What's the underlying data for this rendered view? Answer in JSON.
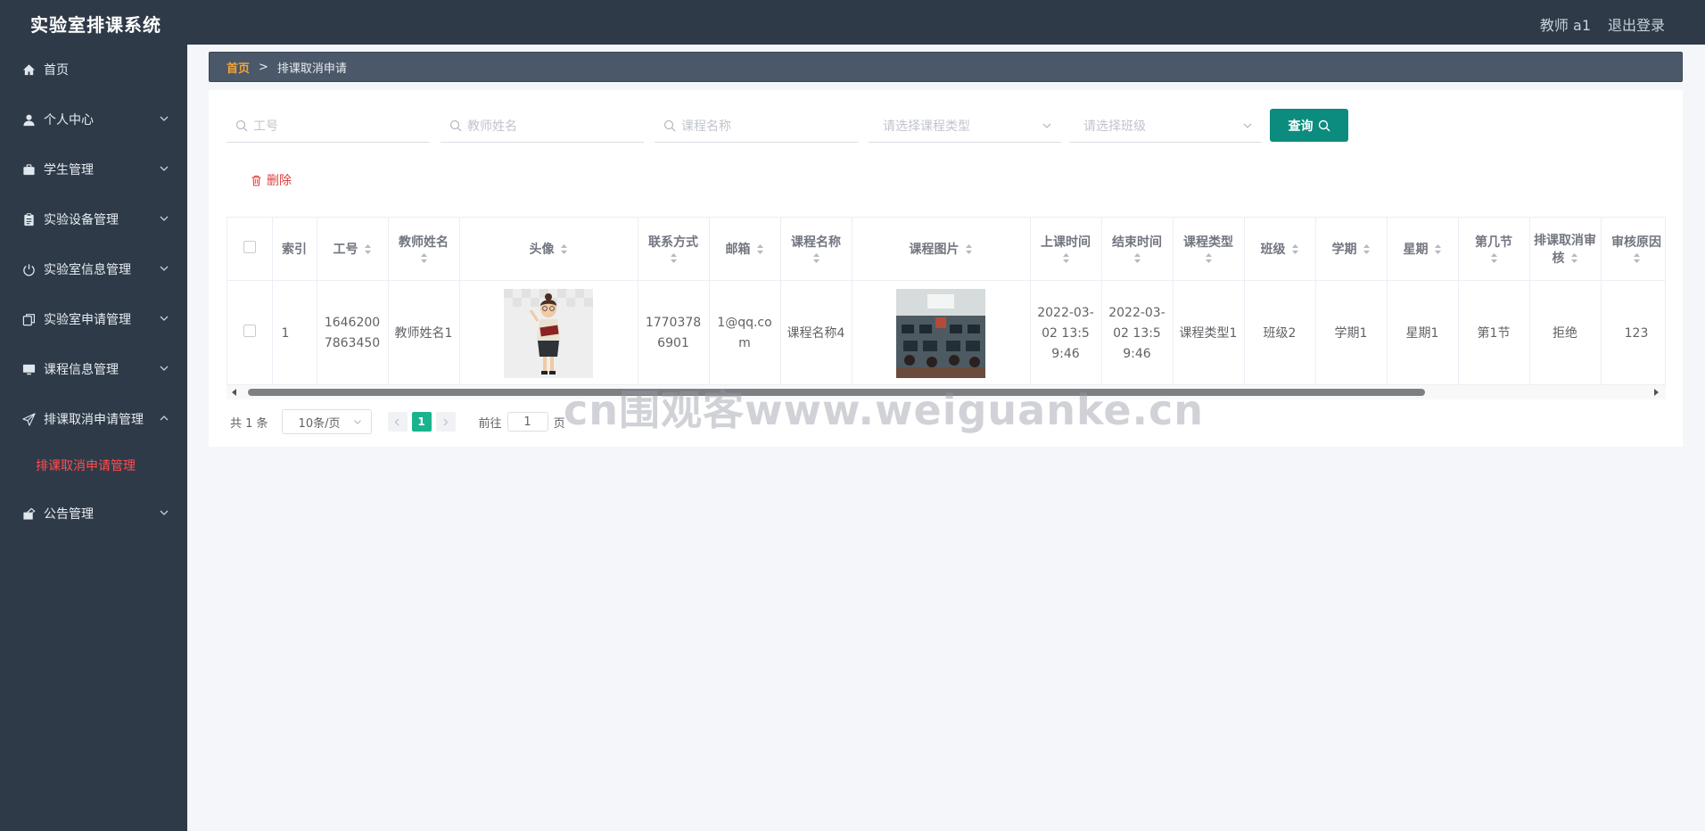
{
  "app": {
    "title": "实验室排课系统"
  },
  "topbar": {
    "user_label": "教师 a1",
    "logout_label": "退出登录"
  },
  "sidebar": {
    "items": [
      {
        "label": "首页",
        "icon": "home-icon",
        "expandable": false
      },
      {
        "label": "个人中心",
        "icon": "user-icon",
        "expandable": true
      },
      {
        "label": "学生管理",
        "icon": "briefcase-icon",
        "expandable": true
      },
      {
        "label": "实验设备管理",
        "icon": "clipboard-icon",
        "expandable": true
      },
      {
        "label": "实验室信息管理",
        "icon": "power-icon",
        "expandable": true
      },
      {
        "label": "实验室申请管理",
        "icon": "copy-icon",
        "expandable": true
      },
      {
        "label": "课程信息管理",
        "icon": "monitor-icon",
        "expandable": true
      },
      {
        "label": "排课取消申请管理",
        "icon": "send-icon",
        "expandable": true,
        "expanded": true
      },
      {
        "label": "公告管理",
        "icon": "notice-icon",
        "expandable": true
      }
    ],
    "submenu": {
      "label": "排课取消申请管理",
      "active_color": "#ff4d4f"
    }
  },
  "breadcrumb": {
    "home": "首页",
    "separator": ">",
    "current": "排课取消申请"
  },
  "search": {
    "employee_id_placeholder": "工号",
    "teacher_name_placeholder": "教师姓名",
    "course_name_placeholder": "课程名称",
    "course_type_placeholder": "请选择课程类型",
    "class_placeholder": "请选择班级",
    "query_label": "查询"
  },
  "actions": {
    "delete_label": "删除"
  },
  "table": {
    "headers": {
      "index": "索引",
      "employee_id": "工号",
      "teacher_name": "教师姓名",
      "avatar": "头像",
      "contact": "联系方式",
      "email": "邮箱",
      "course_name": "课程名称",
      "course_image": "课程图片",
      "start_time": "上课时间",
      "end_time": "结束时间",
      "course_type": "课程类型",
      "class": "班级",
      "semester": "学期",
      "weekday": "星期",
      "period": "第几节",
      "review": "排课取消审核",
      "review_reason": "审核原因"
    },
    "rows": [
      {
        "index": "1",
        "employee_id": "16462007863450",
        "teacher_name": "教师姓名1",
        "contact": "17703786901",
        "email": "1@qq.com",
        "course_name": "课程名称4",
        "start_time": "2022-03-02 13:59:46",
        "end_time": "2022-03-02 13:59:46",
        "course_type": "课程类型1",
        "class": "班级2",
        "semester": "学期1",
        "weekday": "星期1",
        "period": "第1节",
        "review": "拒绝",
        "review_reason": "123"
      }
    ]
  },
  "pagination": {
    "total": "共 1 条",
    "page_size": "10条/页",
    "current_page": "1",
    "goto_prefix": "前往",
    "goto_value": "1",
    "goto_suffix": "页"
  },
  "watermark": "cn围观客www.weiguanke.cn",
  "colors": {
    "sidebar_bg": "#2e3a48",
    "breadcrumb_bg": "#4a5869",
    "accent_orange": "#f0a53c",
    "query_button": "#0c8c7e",
    "danger": "#e23f3f",
    "page_active": "#19b48e"
  }
}
